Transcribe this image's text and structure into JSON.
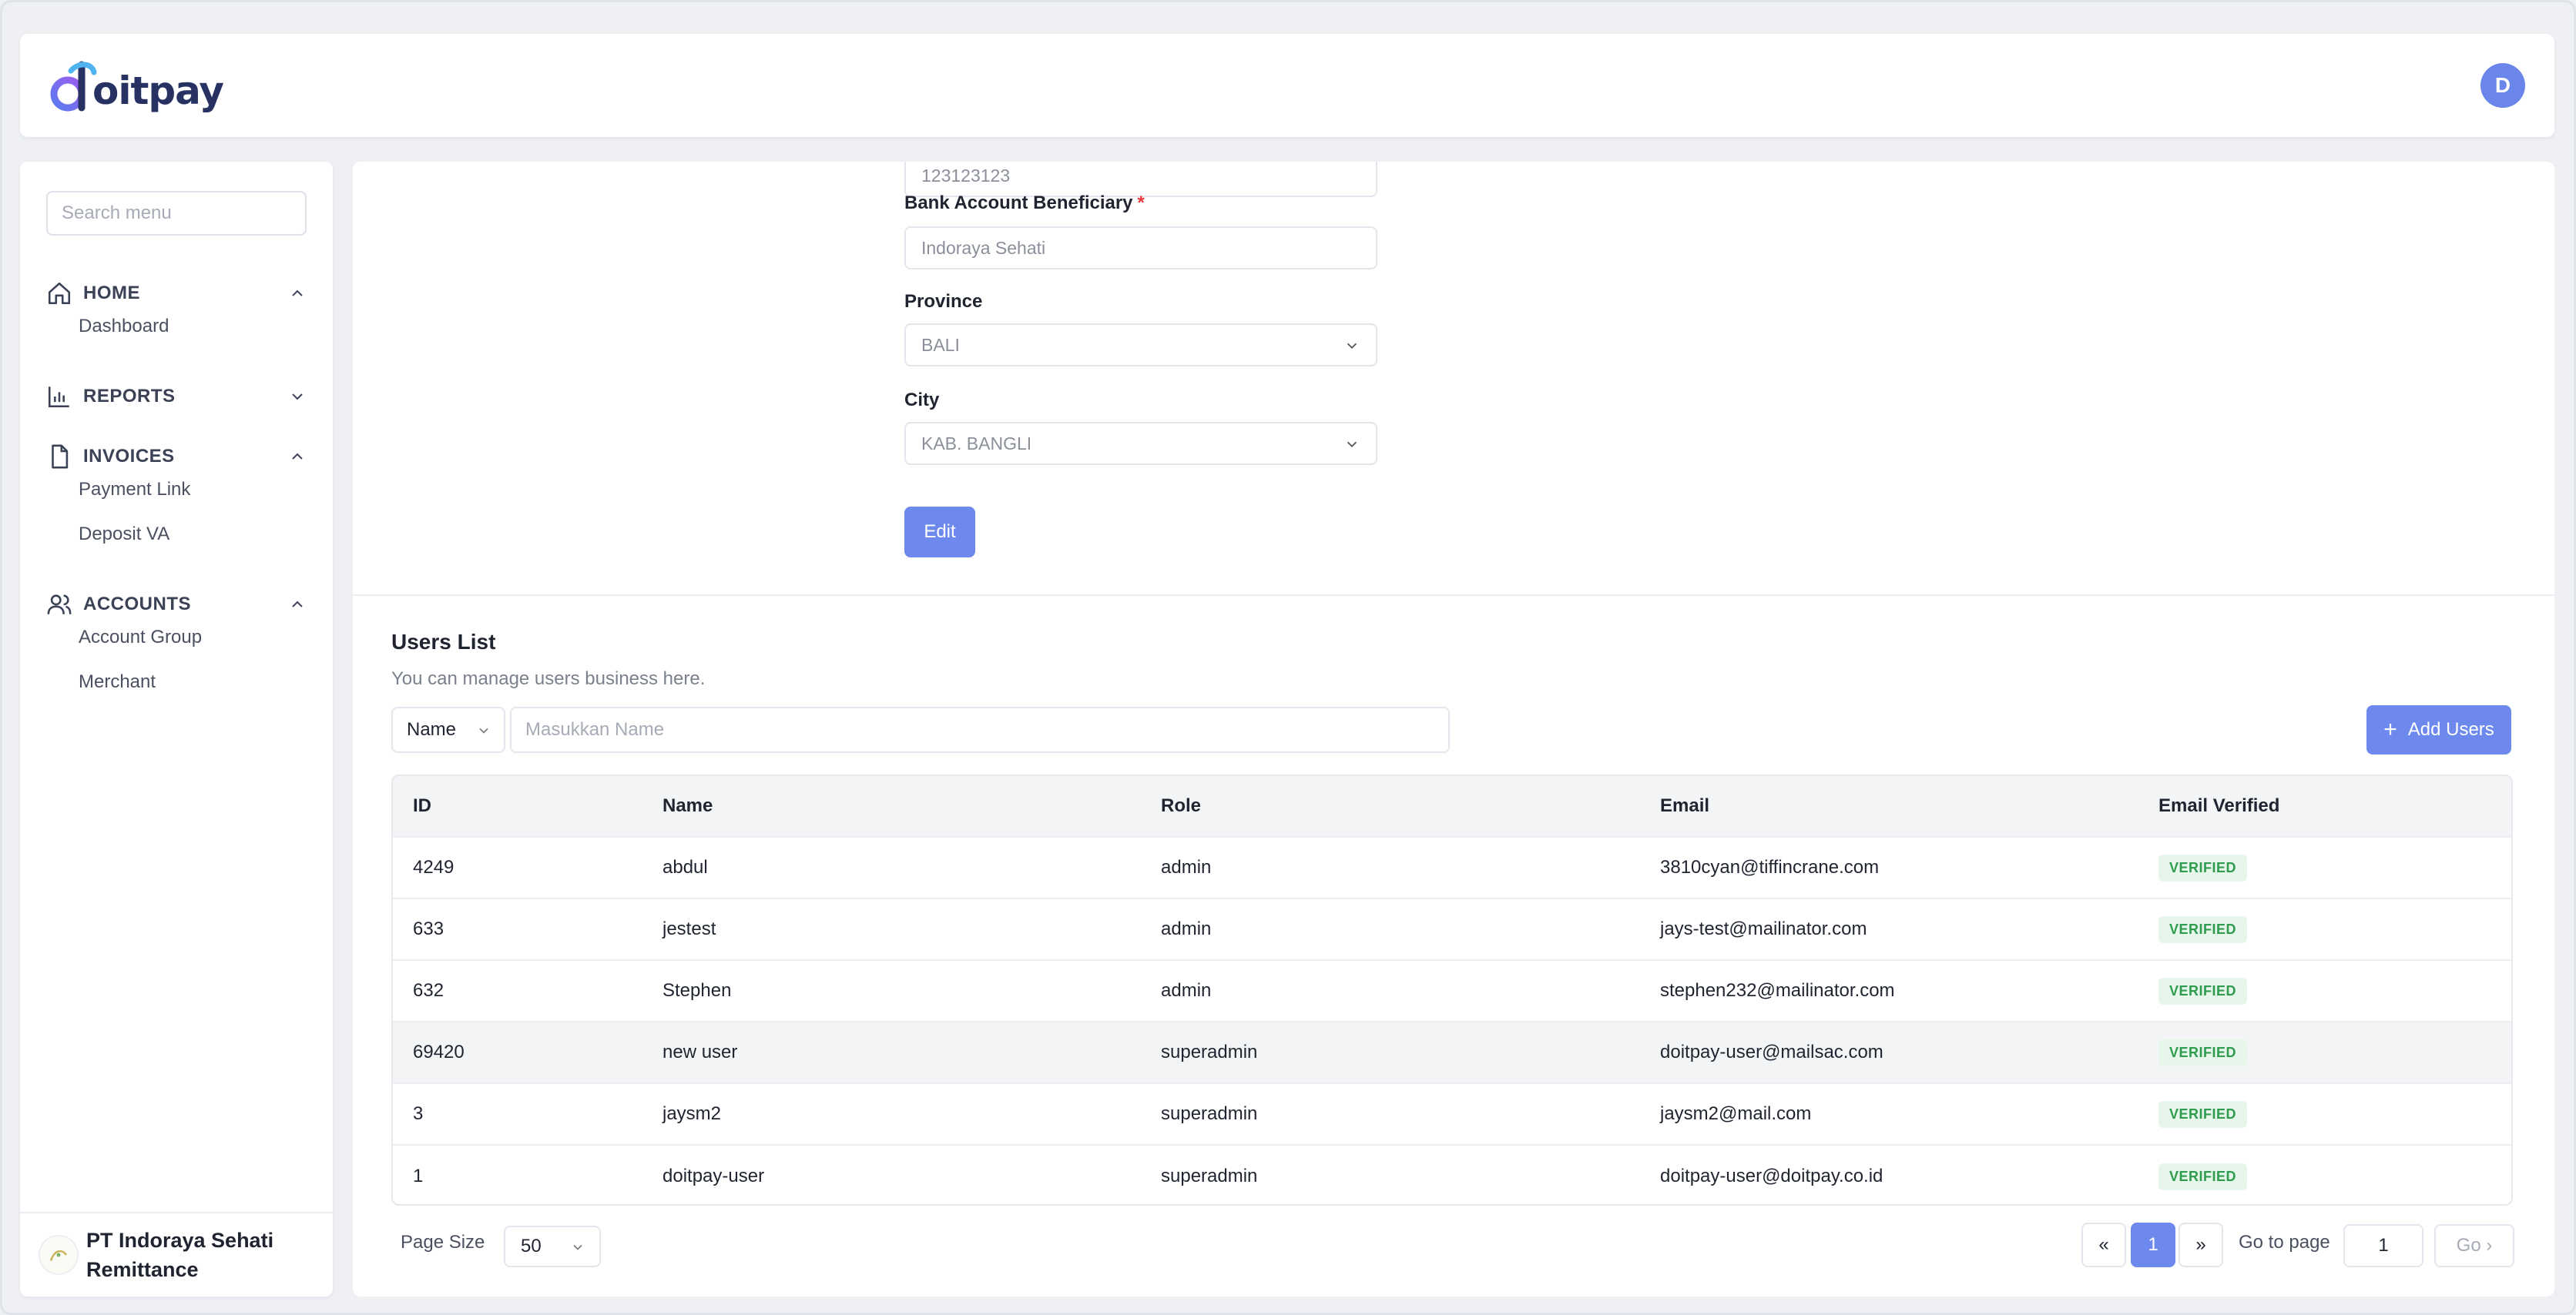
{
  "header": {
    "logo_text": "oitpay",
    "avatar_initial": "D"
  },
  "sidebar": {
    "search_placeholder": "Search menu",
    "sections": [
      {
        "label": "HOME",
        "items": [
          {
            "label": "Dashboard"
          }
        ]
      },
      {
        "label": "REPORTS",
        "items": []
      },
      {
        "label": "INVOICES",
        "items": [
          {
            "label": "Payment Link"
          },
          {
            "label": "Deposit VA"
          }
        ]
      },
      {
        "label": "ACCOUNTS",
        "items": [
          {
            "label": "Account Group"
          },
          {
            "label": "Merchant"
          }
        ]
      }
    ],
    "company_name": "PT Indoraya Sehati Remittance"
  },
  "form": {
    "account_number_value": "123123123",
    "beneficiary_label": "Bank Account Beneficiary",
    "required_mark": "*",
    "beneficiary_value": "Indoraya Sehati",
    "province_label": "Province",
    "province_value": "BALI",
    "city_label": "City",
    "city_value": "KAB. BANGLI",
    "edit_label": "Edit"
  },
  "users": {
    "title": "Users List",
    "subtitle": "You can manage users business here.",
    "filter_field": "Name",
    "filter_placeholder": "Masukkan Name",
    "add_label": "Add Users",
    "columns": [
      "ID",
      "Name",
      "Role",
      "Email",
      "Email Verified"
    ],
    "rows": [
      {
        "id": "4249",
        "name": "abdul",
        "role": "admin",
        "email": "3810cyan@tiffincrane.com",
        "verified": "VERIFIED"
      },
      {
        "id": "633",
        "name": "jestest",
        "role": "admin",
        "email": "jays-test@mailinator.com",
        "verified": "VERIFIED"
      },
      {
        "id": "632",
        "name": "Stephen",
        "role": "admin",
        "email": "stephen232@mailinator.com",
        "verified": "VERIFIED"
      },
      {
        "id": "69420",
        "name": "new user",
        "role": "superadmin",
        "email": "doitpay-user@mailsac.com",
        "verified": "VERIFIED"
      },
      {
        "id": "3",
        "name": "jaysm2",
        "role": "superadmin",
        "email": "jaysm2@mail.com",
        "verified": "VERIFIED"
      },
      {
        "id": "1",
        "name": "doitpay-user",
        "role": "superadmin",
        "email": "doitpay-user@doitpay.co.id",
        "verified": "VERIFIED"
      }
    ]
  },
  "pagination": {
    "page_size_label": "Page Size",
    "page_size_value": "50",
    "first_label": "«",
    "current_page": "1",
    "last_label": "»",
    "goto_label": "Go to page",
    "goto_value": "1",
    "go_label": "Go ›"
  },
  "colors": {
    "accent": "#6e89ee",
    "verified_bg": "#e6f6ea",
    "verified_text": "#2f9b4e",
    "required": "#e5383b"
  }
}
